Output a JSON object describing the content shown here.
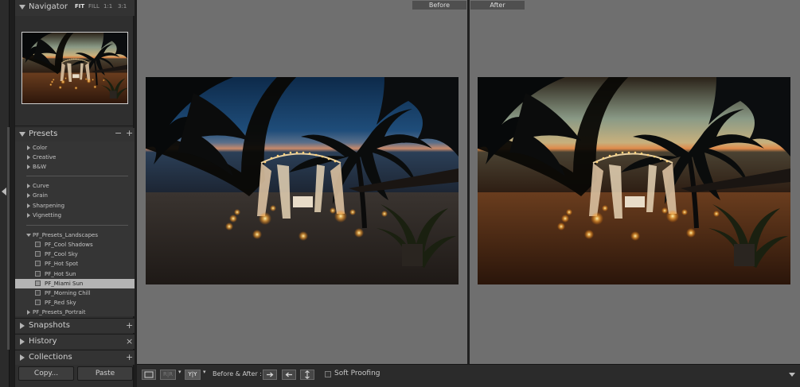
{
  "colors": {
    "accent": "#b4b4b4",
    "panel": "#2f2f2f",
    "canvas": "#6f6f6f"
  },
  "navigator": {
    "title": "Navigator",
    "zoom_options": [
      "FIT",
      "FILL",
      "1:1",
      "3:1"
    ],
    "selected_zoom": "FIT"
  },
  "presets": {
    "title": "Presets",
    "minus": "−",
    "plus": "+",
    "groups": [
      {
        "label": "Color"
      },
      {
        "label": "Creative"
      },
      {
        "label": "B&W"
      },
      {
        "label": "Curve"
      },
      {
        "label": "Grain"
      },
      {
        "label": "Sharpening"
      },
      {
        "label": "Vignetting"
      }
    ],
    "expanded_group": "PF_Presets_Landscapes",
    "items": [
      {
        "label": "PF_Cool Shadows"
      },
      {
        "label": "PF_Cool Sky"
      },
      {
        "label": "PF_Hot Spot"
      },
      {
        "label": "PF_Hot Sun"
      },
      {
        "label": "PF_Miami Sun"
      },
      {
        "label": "PF_Morning Chill"
      },
      {
        "label": "PF_Red Sky"
      }
    ],
    "selected_item": "PF_Miami Sun",
    "collapsed_group": "PF_Presets_Portrait"
  },
  "snapshots": {
    "title": "Snapshots",
    "action": "+"
  },
  "history": {
    "title": "History",
    "action": "×"
  },
  "collections": {
    "title": "Collections",
    "action": "+"
  },
  "buttons": {
    "copy": "Copy...",
    "paste": "Paste"
  },
  "view": {
    "before_label": "Before",
    "after_label": "After"
  },
  "toolbar": {
    "view_rr": "R|R",
    "view_yy": "Y|Y",
    "before_after_label": "Before & After :",
    "soft_proofing_label": "Soft Proofing"
  }
}
